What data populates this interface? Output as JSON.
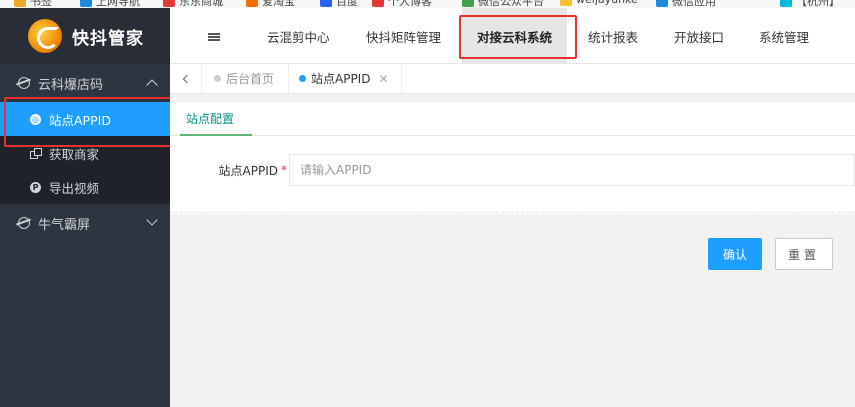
{
  "bookmarks": [
    {
      "label": "书签",
      "color": "#f5a623"
    },
    {
      "label": "上网导航",
      "color": "#1e88e5"
    },
    {
      "label": "东东商城",
      "color": "#e53935"
    },
    {
      "label": "爱淘宝",
      "color": "#ff6d00"
    },
    {
      "label": "百度",
      "color": "#2962ff"
    },
    {
      "label": "个人博客",
      "color": "#e53935"
    },
    {
      "label": "微信公众平台",
      "color": "#43a047"
    },
    {
      "label": "weijayunke",
      "color": "#fbc02d"
    },
    {
      "label": "微信应用",
      "color": "#1e88e5"
    },
    {
      "label": "【杭州】",
      "color": "#00bcd4"
    }
  ],
  "colors": {
    "sidebar_bg": "#2f3540",
    "submenu_bg": "#1f2329",
    "accent_blue": "#1e9fff",
    "active_green": "#009688",
    "highlight_red": "#e8302d"
  },
  "sidebar": {
    "logo_text": "快抖管家",
    "groups": [
      {
        "label": "云科爆店码",
        "icon": "globe-icon",
        "expanded": true,
        "items": [
          {
            "label": "站点APPID",
            "icon": "chrome-icon",
            "active": true
          },
          {
            "label": "获取商家",
            "icon": "copy-icon",
            "active": false
          },
          {
            "label": "导出视频",
            "icon": "p-circle-icon",
            "active": false
          }
        ]
      },
      {
        "label": "牛气霸屏",
        "icon": "globe-icon",
        "expanded": false,
        "items": []
      }
    ]
  },
  "header": {
    "nav": [
      {
        "label": "云混剪中心",
        "active": false
      },
      {
        "label": "快抖矩阵管理",
        "active": false
      },
      {
        "label": "对接云科系统",
        "active": true
      },
      {
        "label": "统计报表",
        "active": false
      },
      {
        "label": "开放接口",
        "active": false
      },
      {
        "label": "系统管理",
        "active": false
      }
    ]
  },
  "tabs": [
    {
      "label": "后台首页",
      "active": false,
      "closable": false
    },
    {
      "label": "站点APPID",
      "active": true,
      "closable": true
    }
  ],
  "content": {
    "subtab": "站点配置",
    "form": {
      "label": "站点APPID",
      "required_mark": "*",
      "placeholder": "请输入APPID",
      "value": ""
    },
    "buttons": {
      "confirm": "确认",
      "reset": "重置"
    }
  }
}
